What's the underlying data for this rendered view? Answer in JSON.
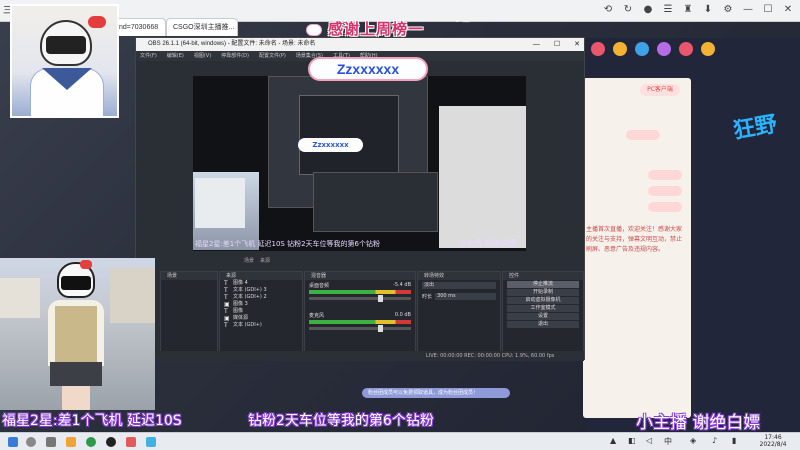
{
  "browser": {
    "app_logo": "三星",
    "tabs": [
      {
        "label": "nd=7030668"
      },
      {
        "label": "CSGO深圳主播推..."
      }
    ],
    "new_tab": "+",
    "toolbar_icons": [
      "clock-icon",
      "refresh-icon",
      "avatar-icon",
      "menu-icon",
      "shirt-icon",
      "download-icon",
      "gear-icon",
      "minimize-icon",
      "maximize-icon",
      "close-icon"
    ]
  },
  "banner": {
    "title": "感谢上周榜一",
    "dots": "• —"
  },
  "obs": {
    "title": "OBS 26.1.1 (64-bit, windows) - 配置文件: 未命名 - 场景: 未命名",
    "window_controls": [
      "—",
      "☐",
      "✕"
    ],
    "menu": [
      "文件(F)",
      "编辑(E)",
      "视图(V)",
      "停靠部件(D)",
      "配置文件(P)",
      "场景集合(S)",
      "工具(T)",
      "帮助(H)"
    ],
    "overlay_name": "Zzxxxxxx",
    "nested_overlay_name": "Zzxxxxxx",
    "preview_caption_left": "福星2星:差1个飞机 延迟10S    钻粉2天车位等我的第6个钻粉",
    "preview_caption_right": "小主播 谢绝白嫖",
    "scene_bar": [
      "场景",
      "来源"
    ],
    "docks": {
      "scenes": {
        "title": "场景"
      },
      "sources": {
        "title": "来源",
        "items": [
          {
            "icon": "T",
            "label": "图像 4"
          },
          {
            "icon": "T",
            "label": "文本 (GDI+) 3"
          },
          {
            "icon": "T",
            "label": "文本 (GDI+) 2"
          },
          {
            "icon": "▣",
            "label": "图像 3"
          },
          {
            "icon": "T",
            "label": "图像"
          },
          {
            "icon": "▣",
            "label": "媒体源"
          },
          {
            "icon": "T",
            "label": "文本 (GDI+)"
          }
        ]
      },
      "mixer": {
        "title": "混音器",
        "channels": [
          {
            "name": "桌面音频",
            "level": "-5.4 dB",
            "volume_fraction": 0.7
          },
          {
            "name": "麦克风",
            "level": "0.0 dB",
            "volume_fraction": 0.7
          }
        ]
      },
      "transitions": {
        "title": "转场特效",
        "type": "淡出",
        "duration_label": "时长",
        "duration_value": "300 ms"
      },
      "controls": {
        "title": "控件",
        "buttons": [
          "停止推流",
          "开始录制",
          "启动虚拟摄像机",
          "工作室模式",
          "设置",
          "退出"
        ]
      }
    },
    "status": "LIVE: 00:00:00  REC: 00:00:00  CPU: 1.9%, 60.00 fps"
  },
  "side_panel": {
    "badge": "PC客户端",
    "text": "主播首次直播，欢迎关注！感谢大家的关注与支持，弹幕文明互动，禁止刷屏、恶意广告及违规内容。"
  },
  "right_deco": "狂野",
  "chat_note": "粉丝团成员可以免费领取道具，成为粉丝团成员！",
  "captions": {
    "left": "福星2星:差1个飞机 延迟10S",
    "middle": "钻粉2天车位等我的第6个钻粉",
    "right": "小主播 谢绝白嫖"
  },
  "taskbar": {
    "icons": [
      "windows-icon",
      "search-icon",
      "taskview-icon",
      "files-icon",
      "browser-icon",
      "obs-icon",
      "app-icon",
      "app2-icon"
    ],
    "clock_time": "17:46",
    "clock_date": "2022/8/4"
  },
  "colors": {
    "caption_outline": "#8a3fd9",
    "banner_pink": "#d6336c",
    "overlay_blue": "#2750d8"
  }
}
